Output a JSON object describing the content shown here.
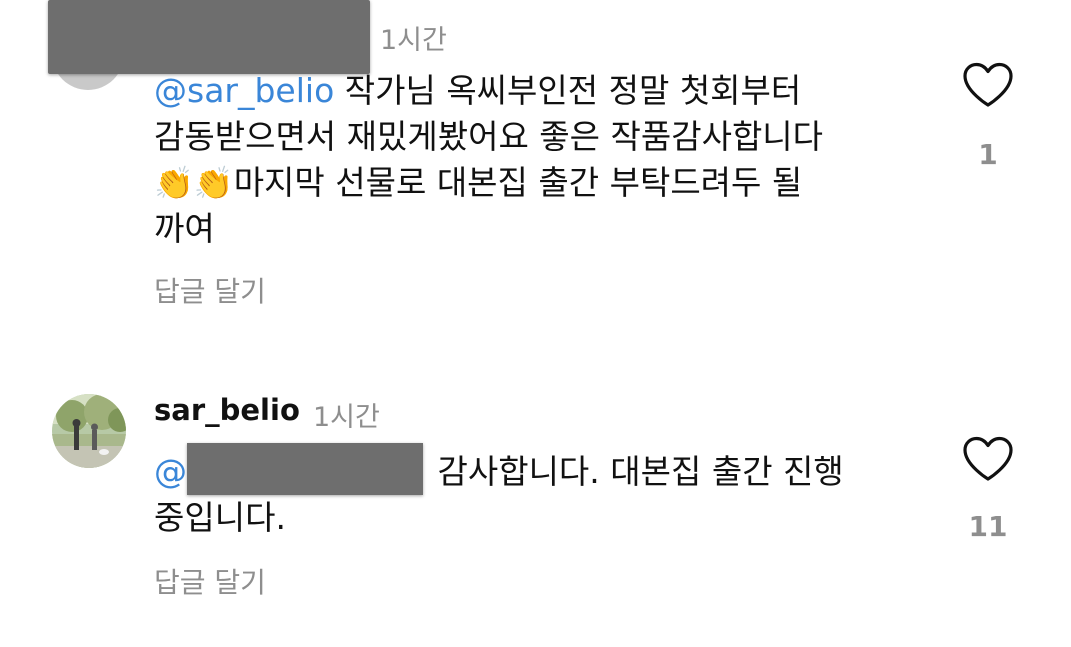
{
  "comments": [
    {
      "time": "1시간",
      "mention": "@sar_belio",
      "text_line1": " 작가님 옥씨부인전 정말 첫회부터",
      "text_line2": "감동받으면서 재밌게봤어요 좋은 작품감사합니다",
      "clap1": "👏",
      "clap2": "👏",
      "text_line3": "마지막 선물로 대본집 출간 부탁드려두 될",
      "text_line4": "까여",
      "reply_label": "답글 달기",
      "likes": "1"
    },
    {
      "username": "sar_belio",
      "time": "1시간",
      "mention_prefix": "@",
      "text_line1": " 감사합니다. 대본집 출간 진행",
      "text_line2": "중입니다.",
      "reply_label": "답글 달기",
      "likes": "11"
    }
  ],
  "icons": {
    "like": "heart-outline-icon",
    "avatar_bg": "#c9c9c9"
  }
}
